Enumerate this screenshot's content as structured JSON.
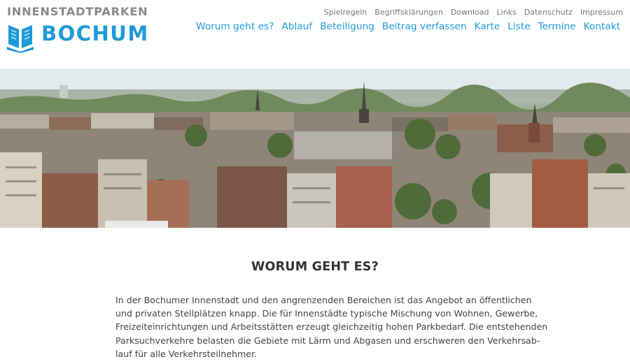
{
  "logo": {
    "top_line": "INNENSTADTPARKEN",
    "city": "BOCHUM",
    "brand_color": "#1e9ad8",
    "icon": "book-icon"
  },
  "meta_nav": [
    "Spielregeln",
    "Begriffsklärungen",
    "Download",
    "Links",
    "Datenschutz",
    "Impressum"
  ],
  "main_nav": [
    "Worum geht es?",
    "Ablauf",
    "Beteiligung",
    "Beitrag verfassen",
    "Karte",
    "Liste",
    "Termine",
    "Kontakt"
  ],
  "hero": {
    "image": "city-skyline-photo"
  },
  "section": {
    "title": "WORUM GEHT ES?",
    "lines": [
      "In der Bochumer Innenstadt und den angrenzenden Bereichen ist das Angebot an öffentlichen",
      "und privaten Stellplätzen knapp. Die für Innenstädte typische Mischung von Wohnen, Gewerbe,",
      "Freizeiteinrichtungen und Arbeitsstätten erzeugt gleichzeitig hohen Parkbedarf. Die entstehenden",
      "Parksuchverkehre belasten die Gebiete mit Lärm und Abgasen und erschweren den Verkehrsab-",
      "lauf für alle Verkehrsteilnehmer."
    ]
  }
}
